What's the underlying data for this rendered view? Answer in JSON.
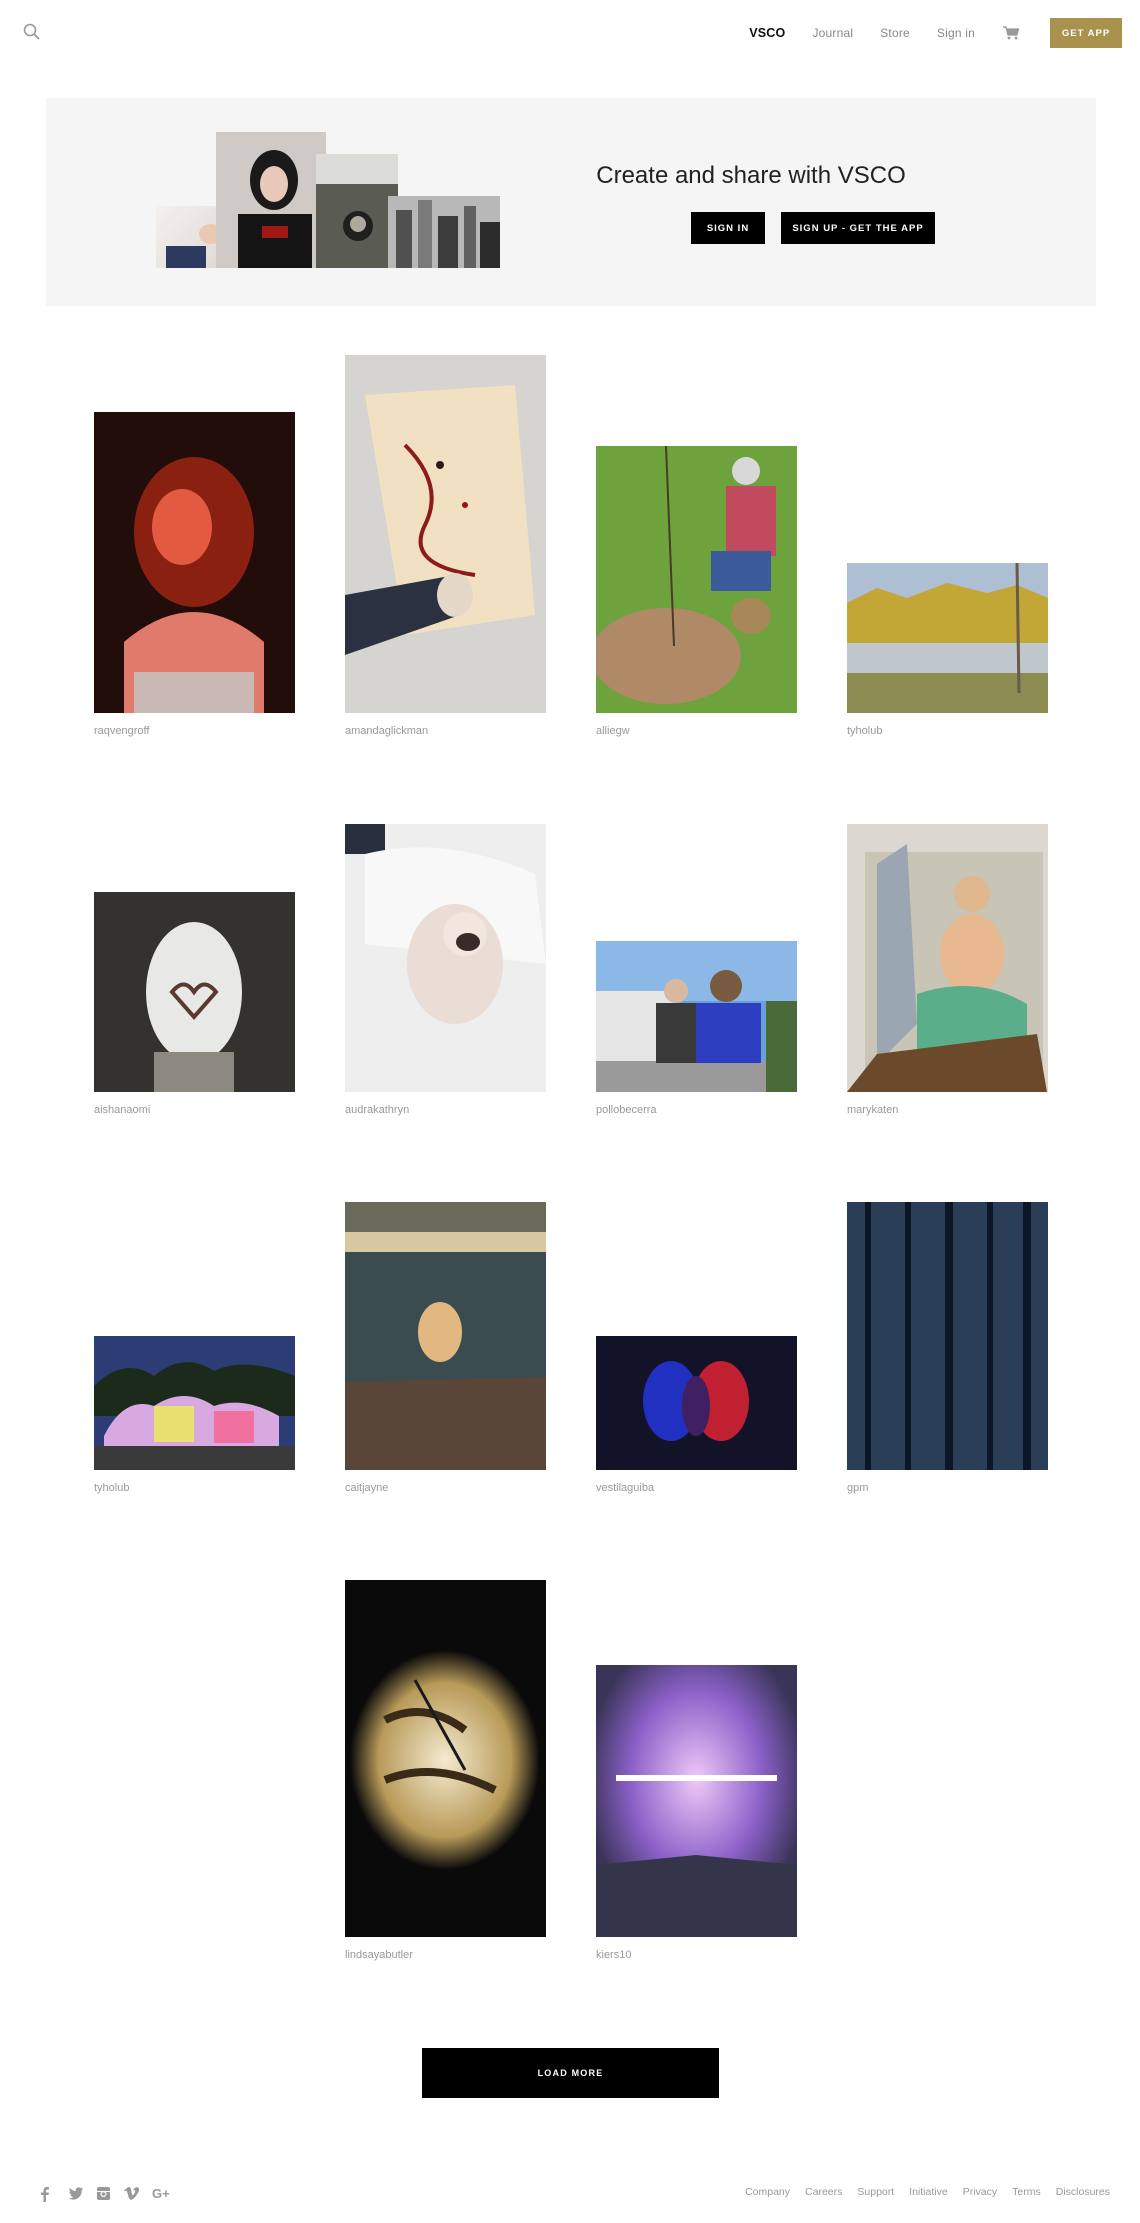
{
  "header": {
    "search_icon": "search-icon",
    "brand": "VSCO",
    "nav": [
      "Journal",
      "Store",
      "Sign in"
    ],
    "cart_icon": "cart-icon",
    "get_app": "GET APP",
    "accent_color": "#a9924d"
  },
  "hero": {
    "title": "Create and share with VSCO",
    "sign_in": "SIGN IN",
    "sign_up": "SIGN UP - GET THE APP",
    "background": "#f5f5f5"
  },
  "grid": {
    "items": [
      {
        "user": "raqvengroff"
      },
      {
        "user": "amandaglickman"
      },
      {
        "user": "alliegw"
      },
      {
        "user": "tyholub"
      },
      {
        "user": "aishanaomi"
      },
      {
        "user": "audrakathryn"
      },
      {
        "user": "pollobecerra"
      },
      {
        "user": "marykaten"
      },
      {
        "user": "tyholub"
      },
      {
        "user": "caitjayne"
      },
      {
        "user": "vestilaguiba"
      },
      {
        "user": "gpm"
      },
      {
        "user": "lindsayabutler"
      },
      {
        "user": "kiers10"
      }
    ]
  },
  "load_more": "LOAD MORE",
  "footer": {
    "social": [
      "facebook-icon",
      "twitter-icon",
      "instagram-icon",
      "vimeo-icon",
      "google-plus-icon"
    ],
    "google_plus_text": "G+",
    "links": [
      "Company",
      "Careers",
      "Support",
      "Initiative",
      "Privacy",
      "Terms",
      "Disclosures"
    ]
  }
}
